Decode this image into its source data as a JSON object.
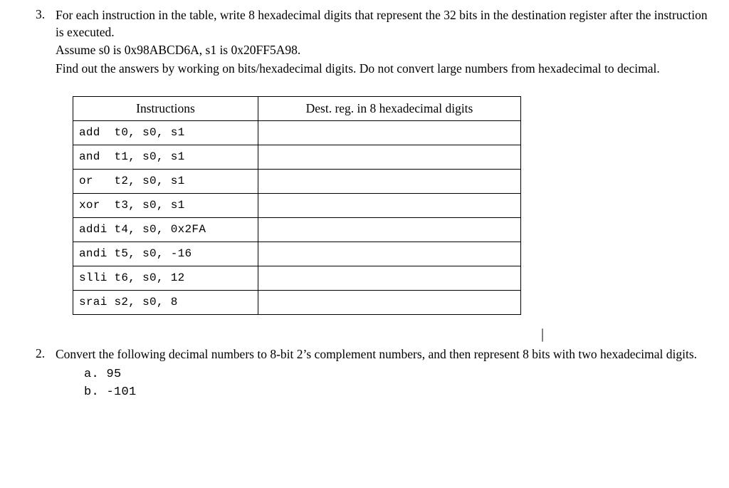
{
  "q3": {
    "number": "3.",
    "p1": "For each instruction in the table, write 8 hexadecimal digits that represent the 32 bits in the destination register after the instruction is executed.",
    "p2": "Assume s0 is 0x98ABCD6A, s1 is 0x20FF5A98.",
    "p3": "Find out the answers by working on bits/hexadecimal digits. Do not convert large numbers from hexadecimal to decimal."
  },
  "table": {
    "headers": [
      "Instructions",
      "Dest. reg. in 8 hexadecimal digits"
    ],
    "rows": [
      {
        "instr": "add  t0, s0, s1",
        "dest": ""
      },
      {
        "instr": "and  t1, s0, s1",
        "dest": ""
      },
      {
        "instr": "or   t2, s0, s1",
        "dest": ""
      },
      {
        "instr": "xor  t3, s0, s1",
        "dest": ""
      },
      {
        "instr": "addi t4, s0, 0x2FA",
        "dest": ""
      },
      {
        "instr": "andi t5, s0, -16",
        "dest": ""
      },
      {
        "instr": "slli t6, s0, 12",
        "dest": ""
      },
      {
        "instr": "srai s2, s0, 8",
        "dest": ""
      }
    ]
  },
  "cursor": "|",
  "q2": {
    "number": "2.",
    "p1": "Convert the following decimal numbers to 8-bit 2’s complement numbers, and then represent 8 bits with two hexadecimal digits.",
    "items": [
      "a. 95",
      "b. -101"
    ]
  }
}
